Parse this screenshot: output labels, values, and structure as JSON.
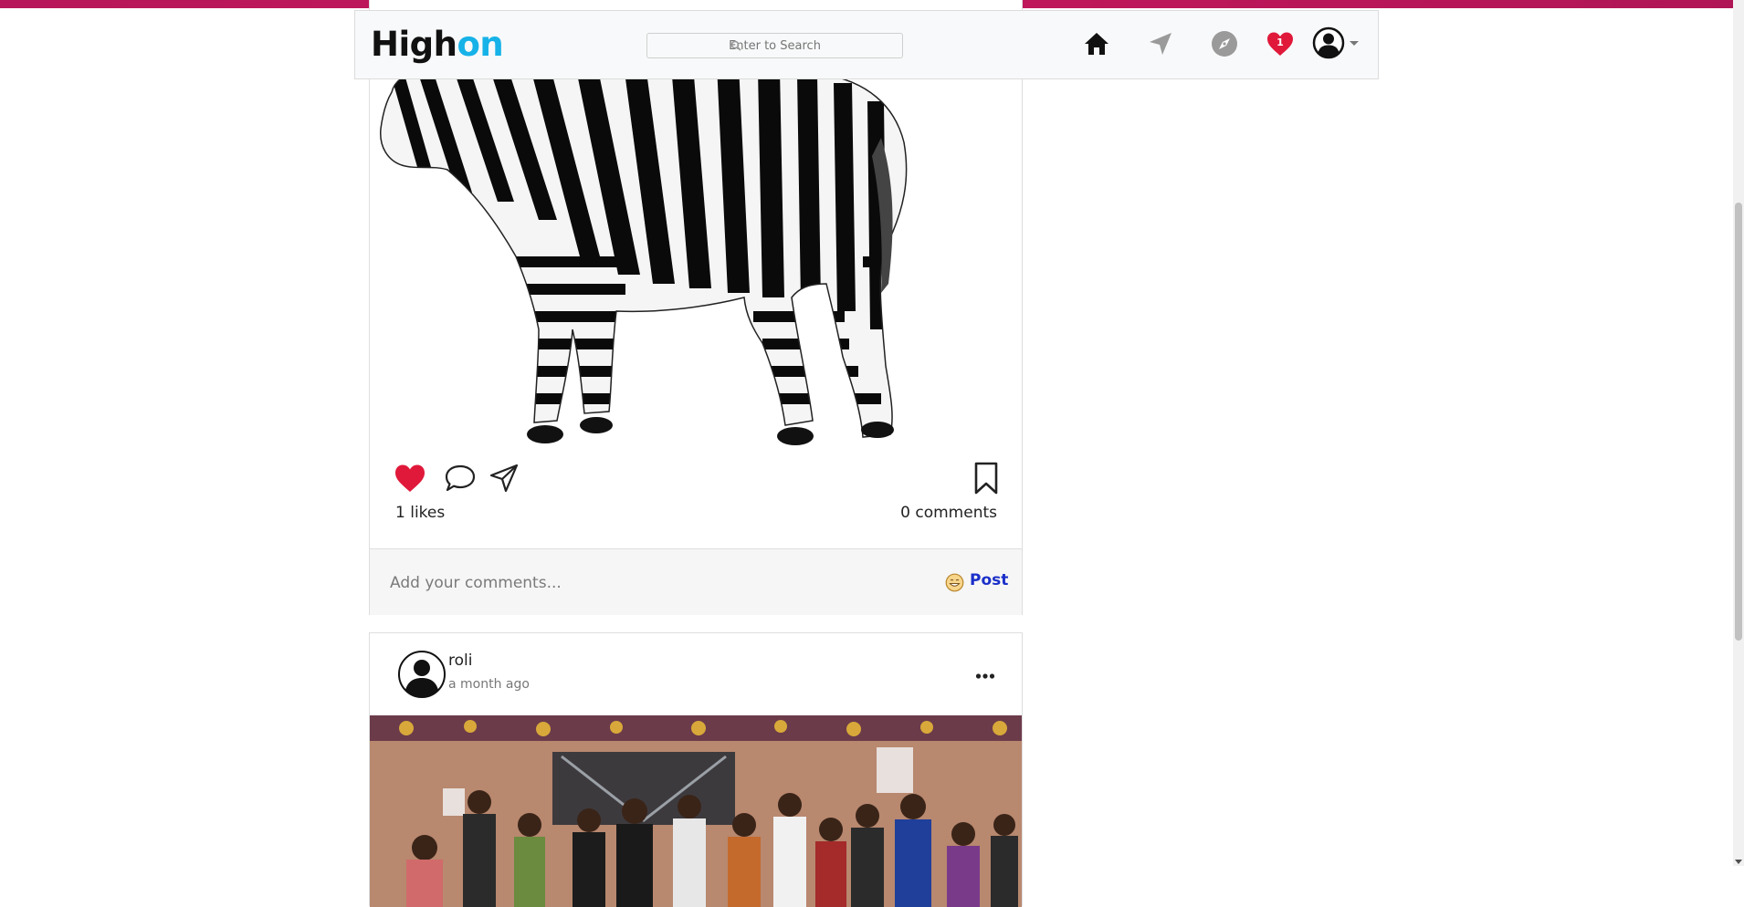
{
  "brand": {
    "part1": "High",
    "part2": "on",
    "color1": "#111111",
    "color2": "#16b2e8"
  },
  "search": {
    "placeholder": "Enter to Search"
  },
  "nav": {
    "icons": [
      "home-icon",
      "send-icon",
      "compass-icon",
      "heart-icon",
      "avatar-icon"
    ],
    "notification_count": "1",
    "heart_color": "#e0193a"
  },
  "posts": [
    {
      "likes_label": "1 likes",
      "comments_label": "0 comments",
      "comment_placeholder": "Add your comments...",
      "post_label": "Post",
      "liked": true
    },
    {
      "username": "roli",
      "timestamp": "a month ago"
    }
  ],
  "colors": {
    "accent_bar": "#c2185b",
    "link": "#1a2fc9",
    "like": "#e0193a"
  }
}
